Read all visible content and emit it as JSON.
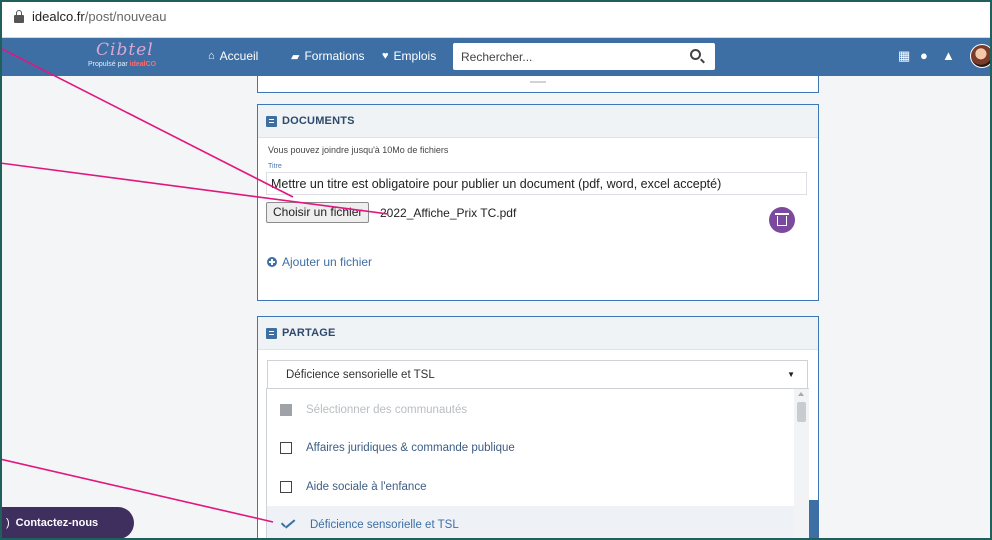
{
  "browser": {
    "url_domain": "idealco.fr",
    "url_path": "/post/nouveau"
  },
  "nav": {
    "logo_text": "Cibtel",
    "logo_byline_prefix": "Propulsé par",
    "logo_byline_brand": "idealCO",
    "links": [
      {
        "label": "Accueil"
      },
      {
        "label": "Formations"
      },
      {
        "label": "Emplois"
      }
    ],
    "search_placeholder": "Rechercher..."
  },
  "documents": {
    "title": "DOCUMENTS",
    "hint": "Vous pouvez joindre jusqu'à 10Mo de fichiers",
    "titre_label": "Titre",
    "titre_value": "Mettre un titre est obligatoire pour publier un document (pdf, word, excel accepté)",
    "choose_file_label": "Choisir un fichier",
    "file_name": "2022_Affiche_Prix TC.pdf",
    "add_file_label": "Ajouter un fichier"
  },
  "partage": {
    "title": "PARTAGE",
    "selected_value": "Déficience sensorielle et TSL",
    "options": [
      {
        "label": "Sélectionner des communautés",
        "state": "disabled"
      },
      {
        "label": "Affaires juridiques & commande publique",
        "state": "unchecked"
      },
      {
        "label": "Aide sociale à l'enfance",
        "state": "unchecked"
      },
      {
        "label": "Déficience sensorielle et TSL",
        "state": "selected"
      }
    ]
  },
  "contact": {
    "label": "Contactez-nous"
  },
  "colors": {
    "nav_bg": "#3d6fa5",
    "accent_magenta": "#e0177f",
    "trash_purple": "#7b4a9e",
    "contact_bg": "#3e2f5e"
  }
}
